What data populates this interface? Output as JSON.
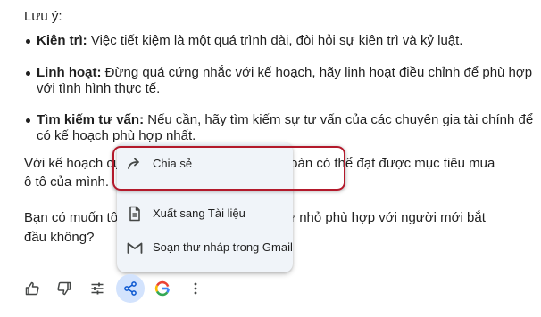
{
  "response": {
    "note_heading": "Lưu ý:",
    "bullets": [
      {
        "term": "Kiên trì:",
        "lines": [
          " Việc tiết kiệm là một quá trình dài, đòi hỏi sự kiên trì và kỷ luật."
        ]
      },
      {
        "term": "Linh hoạt:",
        "lines": [
          " Đừng quá cứng nhắc với kế hoạch, hãy linh hoạt điều chỉnh để phù hợp",
          "với tình hình thực tế."
        ]
      },
      {
        "term": "Tìm kiếm tư vấn:",
        "lines": [
          " Nếu cần, hãy tìm kiếm sự tư vấn của các chuyên gia tài chính để",
          "có kế hoạch phù hợp nhất."
        ]
      }
    ],
    "para1": {
      "left": "Với kế hoạch cụ",
      "right": "toàn có thể đạt được mục tiêu mua",
      "line2": "ô tô của mình."
    },
    "para2": {
      "left": "Bạn có muốn tôi",
      "right": "ư nhỏ phù hợp với người mới bắt",
      "line2": "đầu không?"
    }
  },
  "share_menu": {
    "items": [
      {
        "label": "Chia sẻ",
        "icon": "share-arrow-icon"
      },
      {
        "label": "Xuất sang Tài liệu",
        "icon": "docs-icon"
      },
      {
        "label": "Soạn thư nháp trong Gmail",
        "icon": "gmail-icon"
      }
    ],
    "highlight_color": "#b3192b"
  },
  "actions": {
    "buttons": [
      "thumb-up-icon",
      "thumb-down-icon",
      "tune-icon",
      "share-icon",
      "google-icon",
      "more-vert-icon"
    ],
    "active_color": "#d3e3fd"
  }
}
